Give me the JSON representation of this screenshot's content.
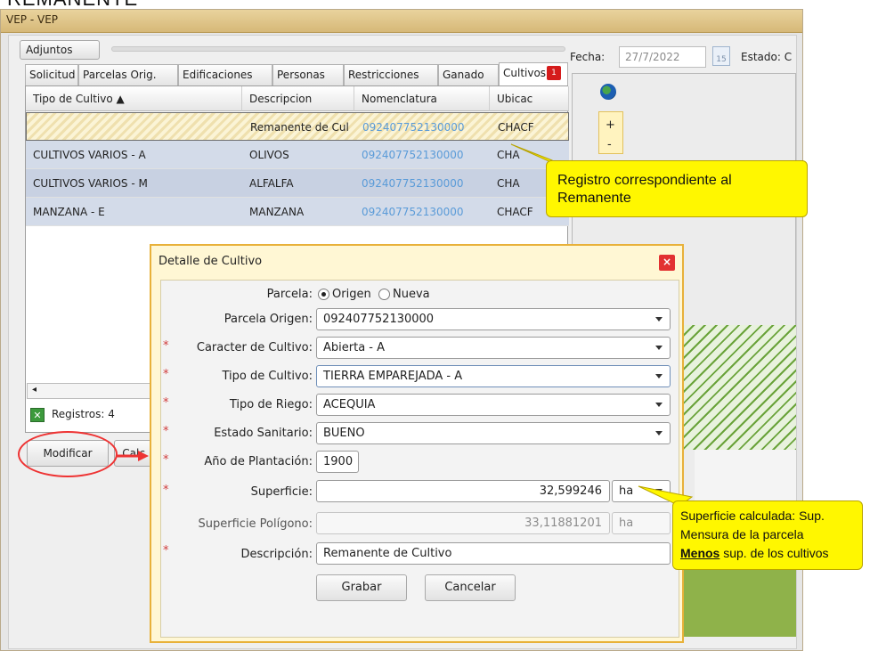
{
  "page": {
    "heading": "REMANENTE"
  },
  "window": {
    "title": "VEP - VEP"
  },
  "toolbar": {
    "adjuntos": "Adjuntos"
  },
  "tabs": [
    {
      "label": "Solicitud"
    },
    {
      "label": "Parcelas Orig."
    },
    {
      "label": "Edificaciones"
    },
    {
      "label": "Personas"
    },
    {
      "label": "Restricciones"
    },
    {
      "label": "Ganado"
    },
    {
      "label": "Cultivos",
      "badge": "1"
    }
  ],
  "grid": {
    "columns": [
      "Tipo de Cultivo ▲",
      "Descripcion",
      "Nomenclatura",
      "Ubicac"
    ],
    "rows": [
      {
        "tipo": "",
        "desc": "Remanente de Cul",
        "nom": "092407752130000",
        "ubic": "CHACF"
      },
      {
        "tipo": "CULTIVOS VARIOS - A",
        "desc": "OLIVOS",
        "nom": "092407752130000",
        "ubic": "CHA"
      },
      {
        "tipo": "CULTIVOS VARIOS - M",
        "desc": "ALFALFA",
        "nom": "092407752130000",
        "ubic": "CHA"
      },
      {
        "tipo": "MANZANA - E",
        "desc": "MANZANA",
        "nom": "092407752130000",
        "ubic": "CHACF"
      }
    ],
    "registros": "Registros: 4"
  },
  "buttons": {
    "modificar": "Modificar",
    "calc": "Calc."
  },
  "header": {
    "fecha_label": "Fecha:",
    "fecha_value": "27/7/2022",
    "calendar_day": "15",
    "estado_label": "Estado: C"
  },
  "map": {
    "zoom_in": "+",
    "zoom_out": "-"
  },
  "callouts": {
    "remanente_line1": "Registro correspondiente al",
    "remanente_line2": "Remanente",
    "sup_line1": "Superficie calculada: Sup.",
    "sup_line2": "Mensura de la parcela",
    "sup_line3_bold": "Menos",
    "sup_line3_rest": " sup. de los cultivos"
  },
  "dialog": {
    "title": "Detalle de Cultivo",
    "close": "x",
    "parcela_label": "Parcela:",
    "radio_origen": "Origen",
    "radio_nueva": "Nueva",
    "parcela_origen_label": "Parcela Origen:",
    "parcela_origen_value": "092407752130000",
    "caracter_label": "Caracter de Cultivo:",
    "caracter_value": "Abierta - A",
    "tipo_label": "Tipo de Cultivo:",
    "tipo_value": "TIERRA EMPAREJADA - A",
    "riego_label": "Tipo de Riego:",
    "riego_value": "ACEQUIA",
    "sanitario_label": "Estado Sanitario:",
    "sanitario_value": "BUENO",
    "anio_label": "Año de Plantación:",
    "anio_value": "1900",
    "superficie_label": "Superficie:",
    "superficie_value": "32,599246",
    "superficie_unit": "ha",
    "sup_poligono_label": "Superficie Polígono:",
    "sup_poligono_value": "33,11881201",
    "sup_poligono_unit": "ha",
    "descripcion_label": "Descripción:",
    "descripcion_value": "Remanente de Cultivo",
    "grabar": "Grabar",
    "cancelar": "Cancelar",
    "required_mark": "*"
  }
}
